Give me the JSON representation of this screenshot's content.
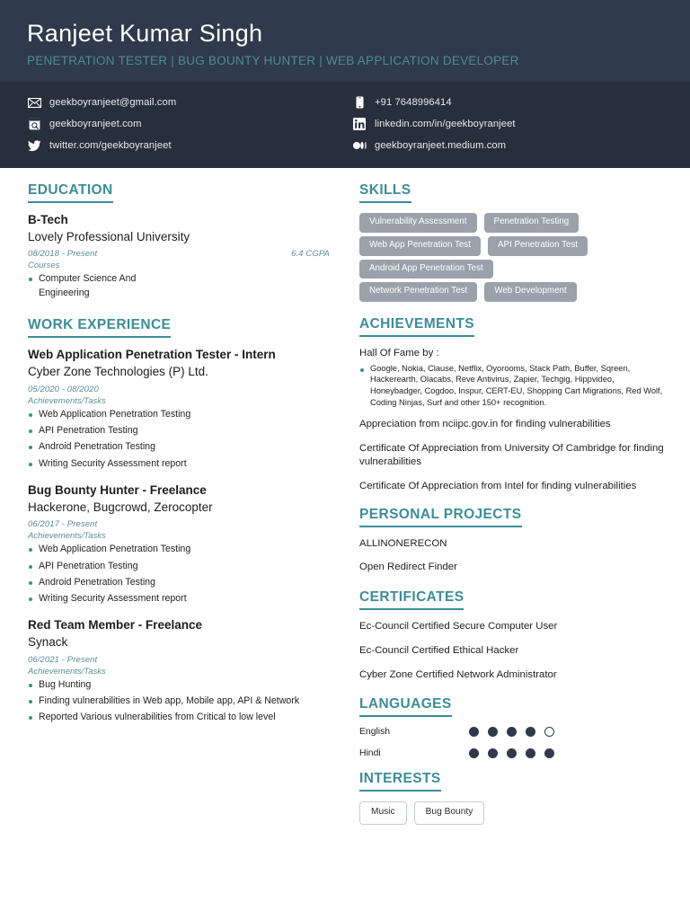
{
  "colors": {
    "header_bg": "#2f3a4c",
    "contact_bg": "#272f3d",
    "accent_teal": "#3c8d97",
    "tagline_teal": "#4d8c96",
    "pill_gray": "#9aa1ab",
    "dot_navy": "#2f3a4c"
  },
  "header": {
    "name": "Ranjeet Kumar Singh",
    "tagline": "PENETRATION TESTER | BUG BOUNTY HUNTER | WEB APPLICATION DEVELOPER"
  },
  "contact": {
    "left": [
      {
        "icon": "envelope-icon",
        "text": "geekboyranjeet@gmail.com"
      },
      {
        "icon": "website-icon",
        "text": "geekboyranjeet.com"
      },
      {
        "icon": "twitter-icon",
        "text": "twitter.com/geekboyranjeet"
      }
    ],
    "right": [
      {
        "icon": "phone-icon",
        "text": "+91 7648996414"
      },
      {
        "icon": "linkedin-icon",
        "text": "linkedin.com/in/geekboyranjeet"
      },
      {
        "icon": "medium-icon",
        "text": "geekboyranjeet.medium.com"
      }
    ]
  },
  "education": {
    "heading": "EDUCATION",
    "entries": [
      {
        "degree": "B-Tech",
        "institution": "Lovely Professional University",
        "dates": "08/2018 - Present",
        "grade": "6.4 CGPA",
        "courses_label": "Courses",
        "courses": [
          "Computer Science And Engineering"
        ]
      }
    ]
  },
  "work_experience": {
    "heading": "WORK EXPERIENCE",
    "entries": [
      {
        "title": "Web Application Penetration Tester - Intern",
        "org": "Cyber Zone Technologies (P) Ltd.",
        "dates": "05/2020 - 08/2020",
        "tasks_label": "Achievements/Tasks",
        "tasks": [
          "Web Application Penetration Testing",
          "API Penetration Testing",
          "Android Penetration Testing",
          "Writing Security Assessment report"
        ]
      },
      {
        "title": "Bug Bounty Hunter - Freelance",
        "org": "Hackerone, Bugcrowd, Zerocopter",
        "dates": "06/2017 - Present",
        "tasks_label": "Achievements/Tasks",
        "tasks": [
          "Web Application Penetration Testing",
          "API Penetration Testing",
          "Android Penetration Testing",
          "Writing Security Assessment report"
        ]
      },
      {
        "title": "Red Team Member - Freelance",
        "org": "Synack",
        "dates": "06/2021 - Present",
        "tasks_label": "Achievements/Tasks",
        "tasks": [
          "Bug Hunting",
          "Finding vulnerabilities in Web app, Mobile app, API & Network",
          "Reported Various vulnerabilities from Critical to low level"
        ]
      }
    ]
  },
  "skills": {
    "heading": "SKILLS",
    "rows": [
      [
        "Vulnerability Assessment",
        "Penetration Testing"
      ],
      [
        "Web App Penetration Test",
        "API Penetration Test"
      ],
      [
        "Android App Penetration Test"
      ],
      [
        "Network Penetration Test",
        "Web Development"
      ]
    ]
  },
  "achievements": {
    "heading": "ACHIEVEMENTS",
    "hall_of_fame_label": "Hall Of Fame by :",
    "hall_of_fame_items": [
      "Google, Nokia, Clause, Netflix, Oyorooms, Stack Path, Buffer, Sqreen, Hackerearth, Olacabs, Reve Antivirus, Zapier, Techgig, Hippvideo, Honeybadger, Cogdoo, Inspur, CERT-EU, Shopping Cart Migrations, Red Wolf, Coding Ninjas, Surf and other 150+ recognition."
    ],
    "items": [
      "Appreciation from nciipc.gov.in for finding vulnerabilities",
      "Certificate Of Appreciation from University Of Cambridge for finding vulnerabilities",
      "Certificate Of Appreciation from Intel for finding vulnerabilities"
    ]
  },
  "personal_projects": {
    "heading": "PERSONAL PROJECTS",
    "items": [
      "ALLINONERECON",
      "Open Redirect Finder"
    ]
  },
  "certificates": {
    "heading": "CERTIFICATES",
    "items": [
      "Ec-Council Certified Secure Computer User",
      "Ec-Council Certified Ethical Hacker",
      "Cyber Zone Certified Network Administrator"
    ]
  },
  "languages": {
    "heading": "LANGUAGES",
    "items": [
      {
        "name": "English",
        "level": 4,
        "total": 5
      },
      {
        "name": "Hindi",
        "level": 5,
        "total": 5
      }
    ]
  },
  "interests": {
    "heading": "INTERESTS",
    "items": [
      "Music",
      "Bug Bounty"
    ]
  }
}
